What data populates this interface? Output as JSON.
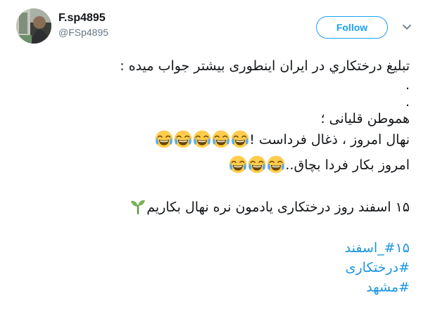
{
  "user": {
    "display_name": "F.sp4895",
    "handle": "@FSp4895"
  },
  "header": {
    "follow_label": "Follow",
    "menu_icon": "chevron-down-icon"
  },
  "tweet": {
    "line1": "تبليغ درختکاري در ایران اینطوری بیشتر جواب میده :",
    "line2": ".",
    "line3": ".",
    "line4": "هموطن قلیانی ؛",
    "line5": "نهال امروز ، ذغال فرداست !",
    "line6": "امروز بکار فردا بچاق..",
    "line7": "۱۵ اسفند روز درختکاری یادمون نره نهال بکاریم",
    "emoji_laughing": "face-with-tears-of-joy",
    "emoji_sprout": "seedling",
    "hashtags": [
      "#۱۵_اسفند",
      "#درختکاری",
      "#مشهد"
    ]
  },
  "colors": {
    "brand_blue": "#1da1f2",
    "link_blue": "#1b95e0",
    "text": "#14171a",
    "muted": "#657786"
  }
}
